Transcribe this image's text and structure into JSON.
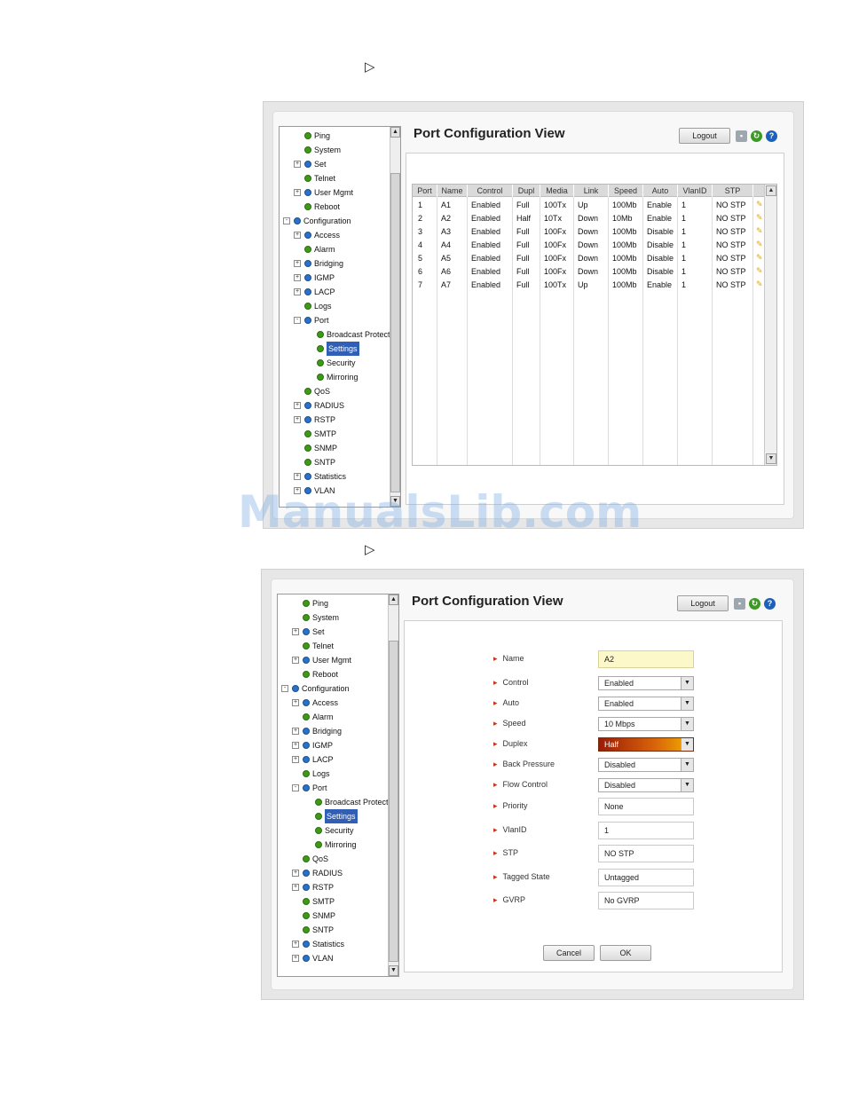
{
  "tree_items": [
    {
      "label": "Ping",
      "lvl": 1,
      "exp": "",
      "icon": "g"
    },
    {
      "label": "System",
      "lvl": 1,
      "exp": "",
      "icon": "g"
    },
    {
      "label": "Set",
      "lvl": 1,
      "exp": "+",
      "icon": "b"
    },
    {
      "label": "Telnet",
      "lvl": 1,
      "exp": "",
      "icon": "g"
    },
    {
      "label": "User Mgmt",
      "lvl": 1,
      "exp": "+",
      "icon": "b"
    },
    {
      "label": "Reboot",
      "lvl": 1,
      "exp": "",
      "icon": "g"
    },
    {
      "label": "Configuration",
      "lvl": 0,
      "exp": "-",
      "icon": "b"
    },
    {
      "label": "Access",
      "lvl": 1,
      "exp": "+",
      "icon": "b"
    },
    {
      "label": "Alarm",
      "lvl": 1,
      "exp": "",
      "icon": "g"
    },
    {
      "label": "Bridging",
      "lvl": 1,
      "exp": "+",
      "icon": "b"
    },
    {
      "label": "IGMP",
      "lvl": 1,
      "exp": "+",
      "icon": "b"
    },
    {
      "label": "LACP",
      "lvl": 1,
      "exp": "+",
      "icon": "b"
    },
    {
      "label": "Logs",
      "lvl": 1,
      "exp": "",
      "icon": "g"
    },
    {
      "label": "Port",
      "lvl": 1,
      "exp": "-",
      "icon": "b"
    },
    {
      "label": "Broadcast Protect",
      "lvl": 2,
      "exp": "",
      "icon": "g"
    },
    {
      "label": "Settings",
      "lvl": 2,
      "exp": "",
      "icon": "g",
      "selected": true
    },
    {
      "label": "Security",
      "lvl": 2,
      "exp": "",
      "icon": "g"
    },
    {
      "label": "Mirroring",
      "lvl": 2,
      "exp": "",
      "icon": "g"
    },
    {
      "label": "QoS",
      "lvl": 1,
      "exp": "",
      "icon": "g"
    },
    {
      "label": "RADIUS",
      "lvl": 1,
      "exp": "+",
      "icon": "b"
    },
    {
      "label": "RSTP",
      "lvl": 1,
      "exp": "+",
      "icon": "b"
    },
    {
      "label": "SMTP",
      "lvl": 1,
      "exp": "",
      "icon": "g"
    },
    {
      "label": "SNMP",
      "lvl": 1,
      "exp": "",
      "icon": "g"
    },
    {
      "label": "SNTP",
      "lvl": 1,
      "exp": "",
      "icon": "g"
    },
    {
      "label": "Statistics",
      "lvl": 1,
      "exp": "+",
      "icon": "b"
    },
    {
      "label": "VLAN",
      "lvl": 1,
      "exp": "+",
      "icon": "b"
    }
  ],
  "header": {
    "title": "Port Configuration View",
    "logout_label": "Logout",
    "save_glyph": "▪",
    "refresh_glyph": "↻",
    "help_glyph": "?"
  },
  "markers": {
    "arrow1": "▷",
    "arrow2": "▷"
  },
  "table": {
    "columns": [
      "Port",
      "Name",
      "Control",
      "Dupl",
      "Media",
      "Link",
      "Speed",
      "Auto",
      "VlanID",
      "STP"
    ],
    "rows": [
      [
        "1",
        "A1",
        "Enabled",
        "Full",
        "100Tx",
        "Up",
        "100Mb",
        "Enable",
        "1",
        "NO STP"
      ],
      [
        "2",
        "A2",
        "Enabled",
        "Half",
        "10Tx",
        "Down",
        "10Mb",
        "Enable",
        "1",
        "NO STP"
      ],
      [
        "3",
        "A3",
        "Enabled",
        "Full",
        "100Fx",
        "Down",
        "100Mb",
        "Disable",
        "1",
        "NO STP"
      ],
      [
        "4",
        "A4",
        "Enabled",
        "Full",
        "100Fx",
        "Down",
        "100Mb",
        "Disable",
        "1",
        "NO STP"
      ],
      [
        "5",
        "A5",
        "Enabled",
        "Full",
        "100Fx",
        "Down",
        "100Mb",
        "Disable",
        "1",
        "NO STP"
      ],
      [
        "6",
        "A6",
        "Enabled",
        "Full",
        "100Fx",
        "Down",
        "100Mb",
        "Disable",
        "1",
        "NO STP"
      ],
      [
        "7",
        "A7",
        "Enabled",
        "Full",
        "100Tx",
        "Up",
        "100Mb",
        "Enable",
        "1",
        "NO STP"
      ]
    ],
    "edit_glyph": "✎"
  },
  "form": {
    "fields": [
      {
        "label": "Name",
        "value": "A2",
        "type": "text",
        "style": "name"
      },
      {
        "label": "Control",
        "value": "Enabled",
        "type": "select"
      },
      {
        "label": "Auto",
        "value": "Enabled",
        "type": "select"
      },
      {
        "label": "Speed",
        "value": "10 Mbps",
        "type": "select"
      },
      {
        "label": "Duplex",
        "value": "Half",
        "type": "select",
        "style": "hot"
      },
      {
        "label": "Back Pressure",
        "value": "Disabled",
        "type": "select"
      },
      {
        "label": "Flow Control",
        "value": "Disabled",
        "type": "select"
      },
      {
        "label": "Priority",
        "value": "None",
        "type": "text"
      },
      {
        "label": "VlanID",
        "value": "1",
        "type": "text"
      },
      {
        "label": "STP",
        "value": "NO STP",
        "type": "text"
      },
      {
        "label": "Tagged State",
        "value": "Untagged",
        "type": "text"
      },
      {
        "label": "GVRP",
        "value": "No GVRP",
        "type": "text"
      }
    ],
    "cancel_label": "Cancel",
    "ok_label": "OK"
  },
  "watermark": "ManualsLib.com"
}
